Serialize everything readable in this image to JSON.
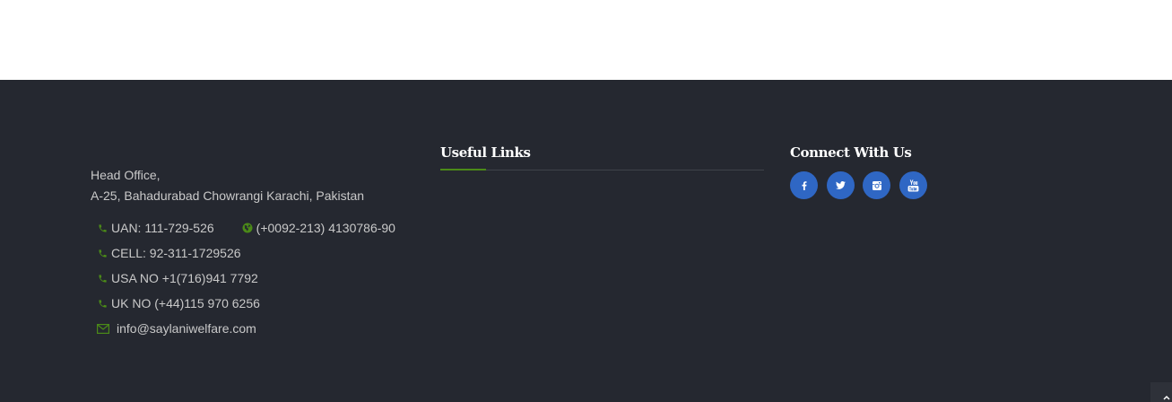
{
  "contact": {
    "address_line1": "Head Office,",
    "address_line2": "A-25, Bahadurabad Chowrangi Karachi, Pakistan",
    "uan": "UAN: 111-729-526",
    "tel": "(+0092-213) 4130786-90",
    "cell": "CELL: 92-311-1729526",
    "usa": "USA NO +1(716)941 7792",
    "uk": "UK NO (+44)115 970 6256",
    "email": "info@saylaniwelfare.com"
  },
  "useful_links": {
    "heading": "Useful Links"
  },
  "connect": {
    "heading": "Connect With Us",
    "icons": [
      "facebook-icon",
      "twitter-icon",
      "instagram-icon",
      "youtube-icon"
    ]
  },
  "colors": {
    "footer_bg": "#252830",
    "accent_green": "#4b8a18",
    "social_blue": "#2f67c4",
    "text": "#c9c9c9"
  }
}
